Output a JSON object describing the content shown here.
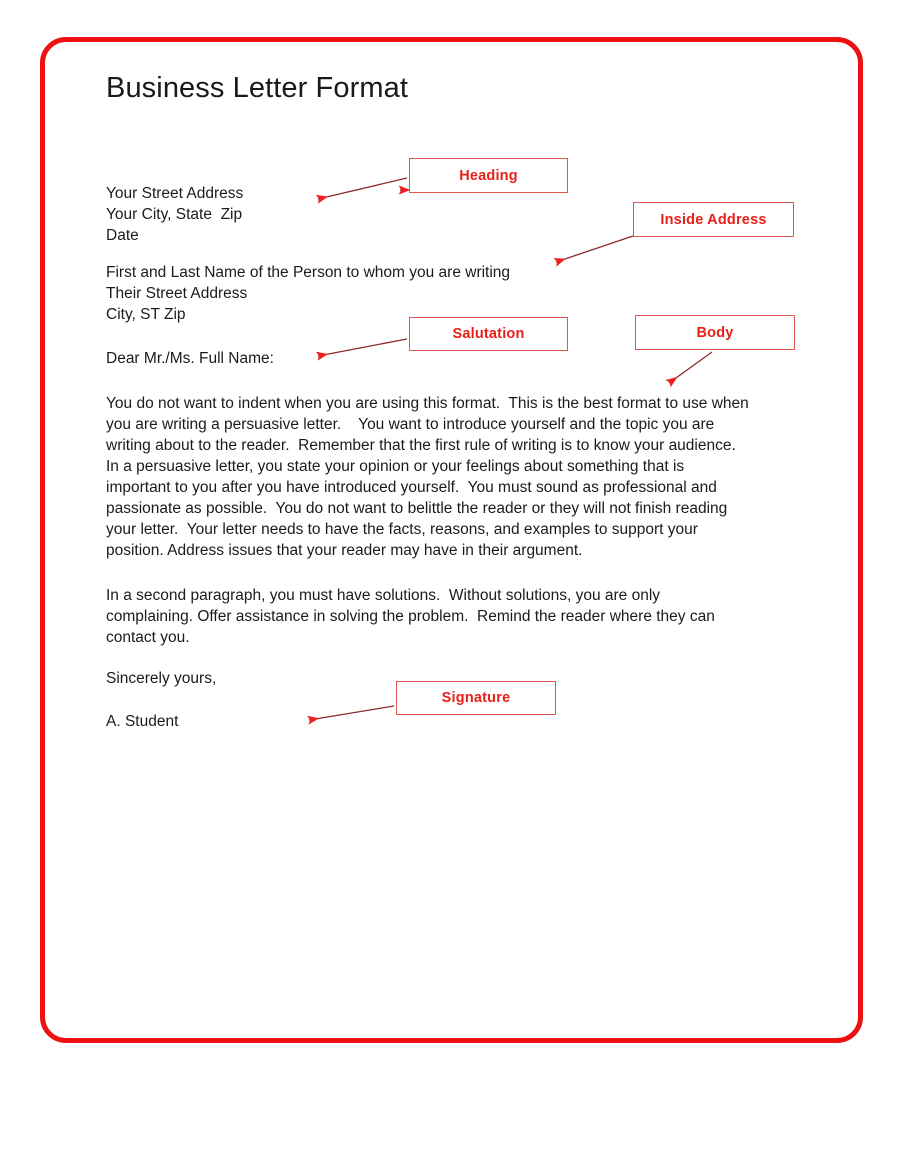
{
  "document": {
    "title": "Business Letter Format",
    "heading_block": "Your Street Address\nYour City, State  Zip\nDate",
    "inside_address_block": "First and Last Name of the Person to whom you are writing\nTheir Street Address\nCity, ST Zip",
    "salutation": "Dear Mr./Ms. Full Name:",
    "body_paragraph_1": "You do not want to indent when you are using this format.  This is the best format to use when you are writing a persuasive letter.    You want to introduce yourself and the topic you are writing about to the reader.  Remember that the first rule of writing is to know your audience.  In a persuasive letter, you state your opinion or your feelings about something that is important to you after you have introduced yourself.  You must sound as professional and passionate as possible.  You do not want to belittle the reader or they will not finish reading your letter.  Your letter needs to have the facts, reasons, and examples to support your position. Address issues that your reader may have in their argument.",
    "body_paragraph_2": "In a second paragraph, you must have solutions.  Without solutions, you are only complaining. Offer assistance in solving the problem.  Remind the reader where they can contact you.",
    "closing": "Sincerely yours,",
    "signature_name": "A. Student"
  },
  "callouts": {
    "heading": "Heading",
    "inside_address": "Inside Address",
    "salutation": "Salutation",
    "body": "Body",
    "signature": "Signature"
  },
  "colors": {
    "frame_red": "#ee1111",
    "callout_text_red": "#e8201a",
    "callout_border_red": "#e0584f",
    "arrow_line": "#8c2b2b",
    "arrow_head": "#ee2020",
    "text_black": "#1b1b1b",
    "page_background": "#ffffff"
  }
}
